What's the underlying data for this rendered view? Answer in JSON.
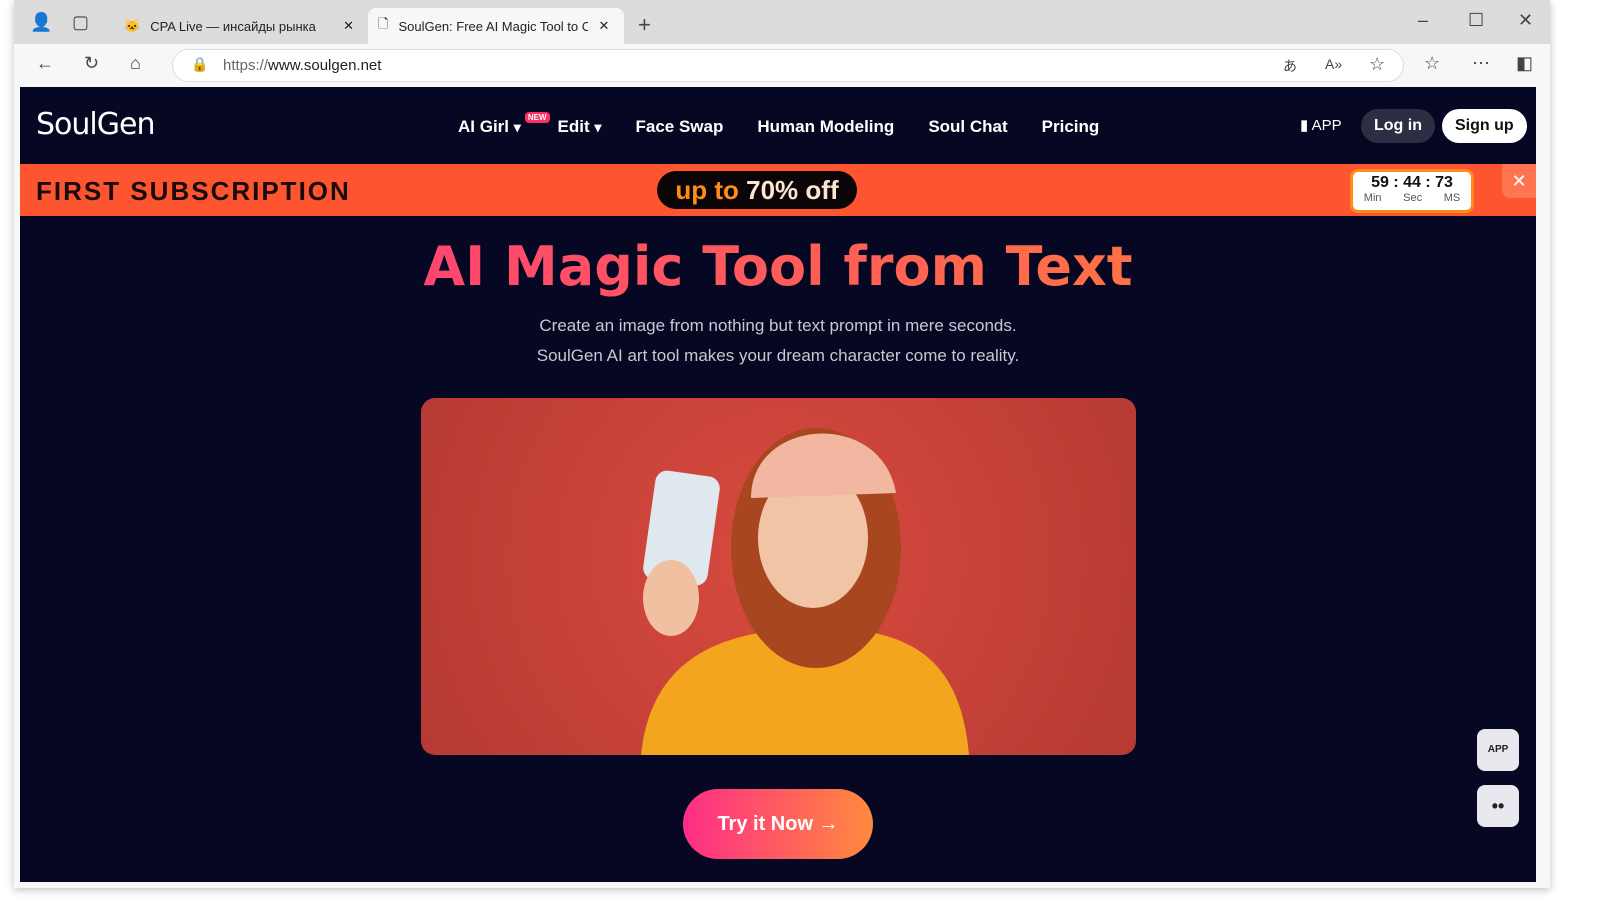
{
  "browser": {
    "tabs": [
      {
        "title": "CPA Live — инсайды рынка"
      },
      {
        "title": "SoulGen: Free AI Magic Tool to Cr"
      }
    ],
    "url_prefix": "https://",
    "url_host": "www.soulgen.net"
  },
  "site": {
    "logo": "SoulGen",
    "menu": [
      {
        "label": "AI Girl",
        "badge": "NEW"
      },
      {
        "label": "Edit"
      },
      {
        "label": "Face Swap"
      },
      {
        "label": "Human Modeling"
      },
      {
        "label": "Soul Chat"
      },
      {
        "label": "Pricing"
      }
    ],
    "app_label": "APP",
    "login": "Log in",
    "signup": "Sign up"
  },
  "promo": {
    "title": "FIRST SUBSCRIPTION",
    "pill_a": "up to",
    "pill_b": "70% off",
    "timer": "59 : 44 : 73",
    "labels": [
      "Min",
      "Sec",
      "MS"
    ],
    "close": "✕"
  },
  "hero": {
    "title": "AI Magic Tool from Text",
    "line1": "Create an image from nothing but text prompt in mere seconds.",
    "line2": "SoulGen AI art tool makes your dream character come to reality.",
    "cta": "Try it Now →"
  },
  "floating": {
    "app": "APP"
  }
}
